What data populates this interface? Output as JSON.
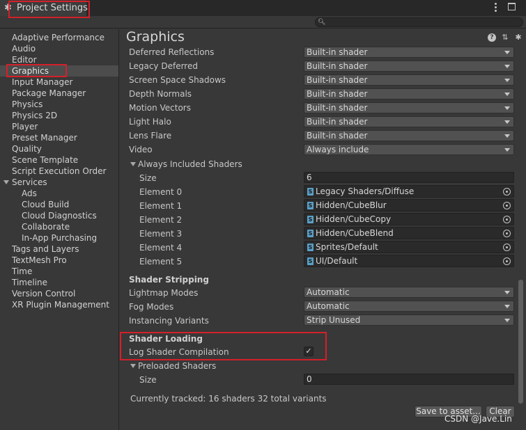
{
  "window": {
    "title": "Project Settings",
    "icons": {
      "title": "gear-icon",
      "menu": "kebab-menu-icon",
      "maximize": "maximize-icon"
    }
  },
  "search": {
    "placeholder": "",
    "value": ""
  },
  "sidebar": {
    "selected": "Graphics",
    "items": [
      "Adaptive Performance",
      "Audio",
      "Editor",
      "Graphics",
      "Input Manager",
      "Package Manager",
      "Physics",
      "Physics 2D",
      "Player",
      "Preset Manager",
      "Quality",
      "Scene Template",
      "Script Execution Order",
      "Services",
      "Ads",
      "Cloud Build",
      "Cloud Diagnostics",
      "Collaborate",
      "In-App Purchasing",
      "Tags and Layers",
      "TextMesh Pro",
      "Time",
      "Timeline",
      "Version Control",
      "XR Plugin Management"
    ]
  },
  "main": {
    "title": "Graphics",
    "header_icons": [
      "help-icon",
      "preset-icon",
      "settings-icon"
    ],
    "builtin_rows": [
      {
        "label": "Deferred Reflections",
        "value": "Built-in shader"
      },
      {
        "label": "Legacy Deferred",
        "value": "Built-in shader"
      },
      {
        "label": "Screen Space Shadows",
        "value": "Built-in shader"
      },
      {
        "label": "Depth Normals",
        "value": "Built-in shader"
      },
      {
        "label": "Motion Vectors",
        "value": "Built-in shader"
      },
      {
        "label": "Light Halo",
        "value": "Built-in shader"
      },
      {
        "label": "Lens Flare",
        "value": "Built-in shader"
      },
      {
        "label": "Video",
        "value": "Always include"
      }
    ],
    "always_included": {
      "label": "Always Included Shaders",
      "size_label": "Size",
      "size": "6",
      "elements": [
        {
          "label": "Element 0",
          "value": "Legacy Shaders/Diffuse"
        },
        {
          "label": "Element 1",
          "value": "Hidden/CubeBlur"
        },
        {
          "label": "Element 2",
          "value": "Hidden/CubeCopy"
        },
        {
          "label": "Element 3",
          "value": "Hidden/CubeBlend"
        },
        {
          "label": "Element 4",
          "value": "Sprites/Default"
        },
        {
          "label": "Element 5",
          "value": "UI/Default"
        }
      ]
    },
    "shader_stripping": {
      "heading": "Shader Stripping",
      "rows": [
        {
          "label": "Lightmap Modes",
          "value": "Automatic"
        },
        {
          "label": "Fog Modes",
          "value": "Automatic"
        },
        {
          "label": "Instancing Variants",
          "value": "Strip Unused"
        }
      ]
    },
    "shader_loading": {
      "heading": "Shader Loading",
      "log_label": "Log Shader Compilation",
      "log_checked": true,
      "checkmark": "✓",
      "preloaded_label": "Preloaded Shaders",
      "size_label": "Size",
      "size": "0"
    },
    "tracked_text": "Currently tracked: 16 shaders 32 total variants",
    "buttons": {
      "save": "Save to asset...",
      "clear": "Clear"
    }
  },
  "watermark": "CSDN @Jave.Lin",
  "colors": {
    "annotation": "#d4202a",
    "background": "#383838",
    "selected": "#4c4c4c"
  }
}
